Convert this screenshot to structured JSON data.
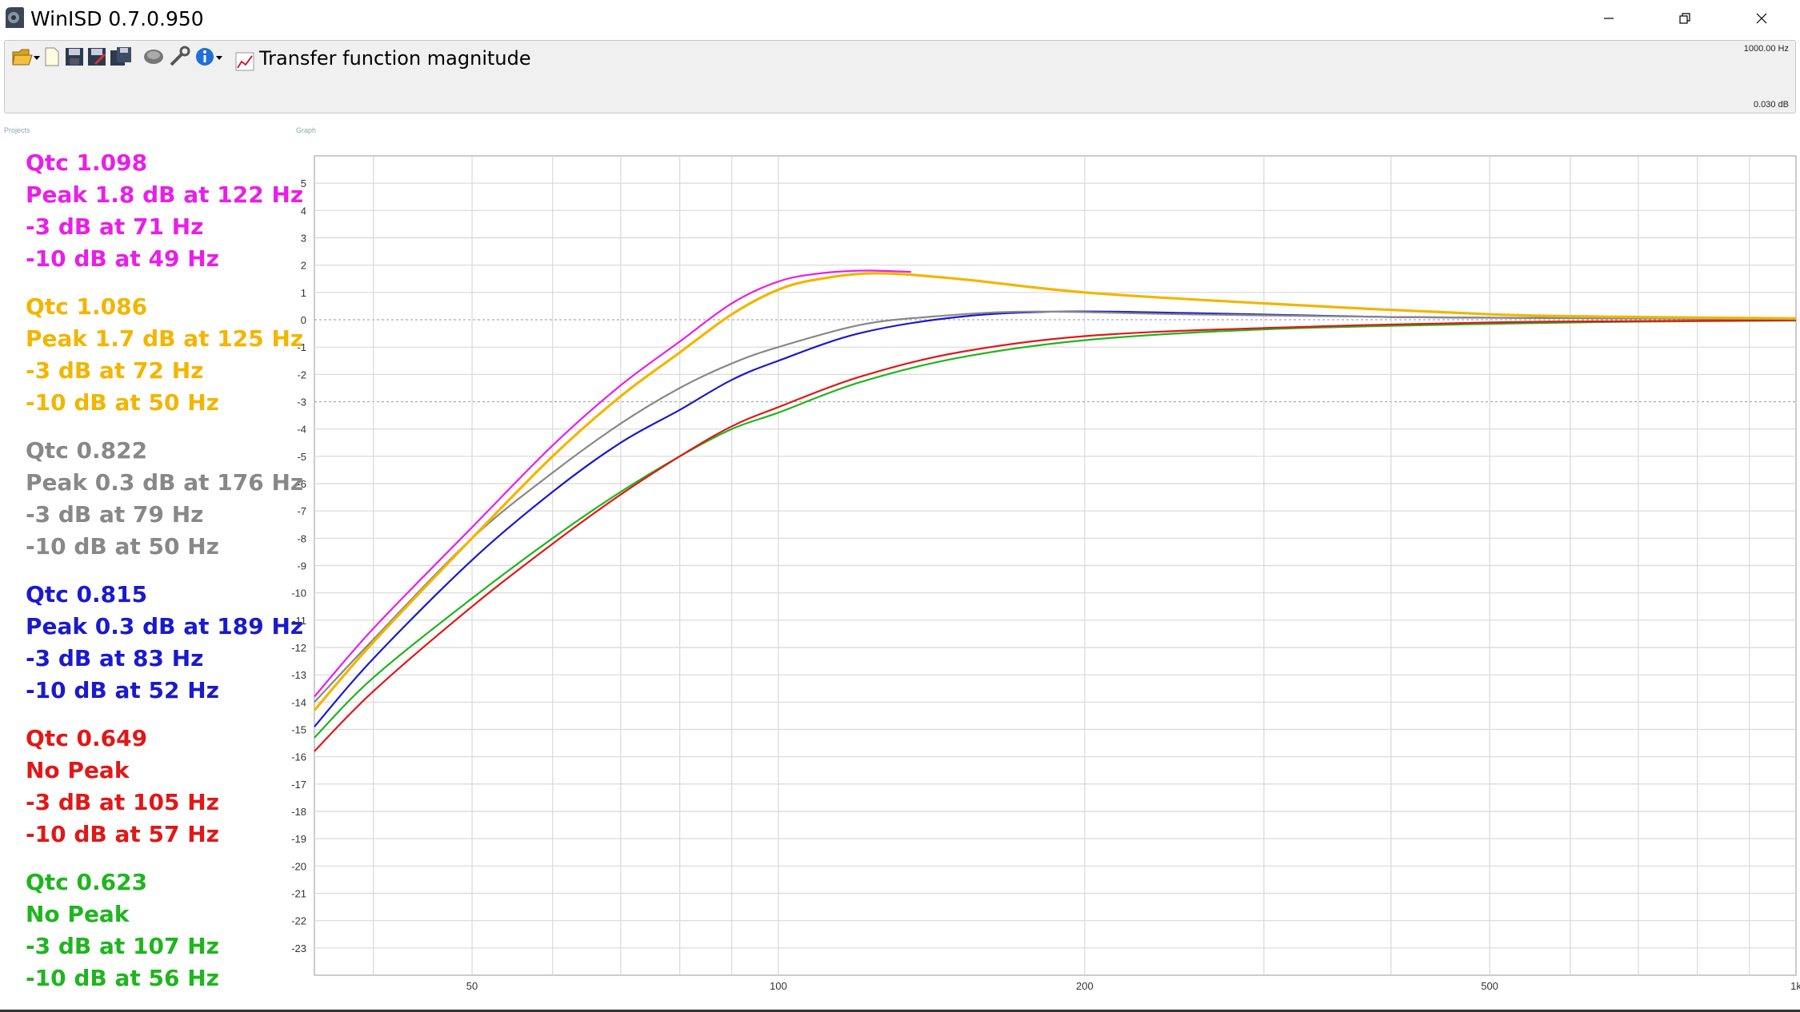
{
  "window": {
    "title": "WinISD 0.7.0.950",
    "controls": [
      "minimize",
      "maximize",
      "close"
    ]
  },
  "toolbar": {
    "icons": [
      "folder-open-icon",
      "new-file-icon",
      "save-icon",
      "save-as-icon",
      "save-all-icon",
      "driver-icon",
      "tools-icon",
      "info-icon"
    ],
    "graph_label": "Transfer function magnitude",
    "freq_readout": "1000.00 Hz",
    "db_readout": "0.030 dB"
  },
  "panels": {
    "projects_caption": "Projects",
    "graph_caption": "Graph"
  },
  "annotations": [
    {
      "color": "#e81fe8",
      "lines": [
        "Qtc 1.098",
        "Peak 1.8 dB at 122 Hz",
        "-3 dB at 71 Hz",
        "-10 dB at 49 Hz"
      ]
    },
    {
      "color": "#f2b500",
      "lines": [
        "Qtc 1.086",
        "Peak 1.7 dB at 125 Hz",
        "-3 dB at 72 Hz",
        "-10 dB at 50 Hz"
      ]
    },
    {
      "color": "#888888",
      "lines": [
        "Qtc 0.822",
        "Peak 0.3 dB at 176 Hz",
        "-3 dB at 79 Hz",
        "-10 dB at 50 Hz"
      ]
    },
    {
      "color": "#1a1acc",
      "lines": [
        "Qtc 0.815",
        "Peak 0.3 dB at 189 Hz",
        "-3 dB at 83 Hz",
        "-10 dB at 52 Hz"
      ]
    },
    {
      "color": "#e01818",
      "lines": [
        "Qtc 0.649",
        "No Peak",
        "-3 dB at 105 Hz",
        "-10 dB at 57 Hz"
      ]
    },
    {
      "color": "#1fb51f",
      "lines": [
        "Qtc 0.623",
        "No Peak",
        "-3 dB at 107 Hz",
        "-10 dB at 56 Hz"
      ]
    }
  ],
  "chart_data": {
    "type": "line",
    "x_scale": "log",
    "xlim": [
      35,
      1000
    ],
    "ylim": [
      -24,
      6
    ],
    "x_ticks": [
      50,
      100,
      200,
      500,
      1000
    ],
    "x_tick_labels": [
      "50",
      "100",
      "200",
      "500",
      "1k"
    ],
    "y_ticks": [
      5,
      4,
      3,
      2,
      1,
      0,
      -1,
      -2,
      -3,
      -4,
      -5,
      -6,
      -7,
      -8,
      -9,
      -10,
      -11,
      -12,
      -13,
      -14,
      -15,
      -16,
      -17,
      -18,
      -19,
      -20,
      -21,
      -22,
      -23
    ],
    "x_grid": [
      40,
      50,
      60,
      70,
      80,
      90,
      100,
      200,
      300,
      400,
      500,
      600,
      700,
      800,
      900
    ],
    "dotted_y": [
      0,
      -3
    ],
    "series": [
      {
        "color": "#e81fe8",
        "qtc": 1.098,
        "x": [
          35,
          40,
          50,
          60,
          70,
          80,
          90,
          100,
          110,
          122,
          135
        ],
        "y": [
          -13.8,
          -11.3,
          -7.6,
          -4.6,
          -2.4,
          -0.8,
          0.6,
          1.4,
          1.7,
          1.8,
          1.75
        ]
      },
      {
        "color": "#f2b500",
        "qtc": 1.086,
        "x": [
          35,
          40,
          50,
          60,
          70,
          80,
          90,
          100,
          110,
          125,
          150,
          200,
          300,
          500,
          700,
          1000
        ],
        "y": [
          -14.3,
          -11.8,
          -8.0,
          -5.0,
          -2.8,
          -1.2,
          0.2,
          1.1,
          1.5,
          1.7,
          1.5,
          1.0,
          0.6,
          0.2,
          0.1,
          0.05
        ]
      },
      {
        "color": "#888888",
        "qtc": 0.822,
        "x": [
          35,
          40,
          50,
          60,
          70,
          80,
          90,
          100,
          120,
          140,
          176,
          250,
          400,
          700,
          1000
        ],
        "y": [
          -14.0,
          -11.7,
          -8.0,
          -5.6,
          -3.8,
          -2.5,
          -1.6,
          -1.0,
          -0.2,
          0.1,
          0.3,
          0.2,
          0.1,
          0.05,
          0.02
        ]
      },
      {
        "color": "#1a1acc",
        "qtc": 0.815,
        "x": [
          35,
          40,
          50,
          60,
          70,
          80,
          90,
          100,
          120,
          150,
          189,
          250,
          400,
          700,
          1000
        ],
        "y": [
          -14.9,
          -12.4,
          -8.8,
          -6.3,
          -4.5,
          -3.3,
          -2.2,
          -1.5,
          -0.5,
          0.1,
          0.3,
          0.25,
          0.1,
          0.05,
          0.02
        ]
      },
      {
        "color": "#e01818",
        "qtc": 0.649,
        "x": [
          35,
          40,
          50,
          60,
          70,
          80,
          90,
          100,
          120,
          150,
          200,
          300,
          500,
          700,
          1000
        ],
        "y": [
          -15.8,
          -13.6,
          -10.5,
          -8.2,
          -6.4,
          -5.0,
          -3.9,
          -3.2,
          -2.1,
          -1.2,
          -0.6,
          -0.3,
          -0.1,
          -0.05,
          -0.02
        ]
      },
      {
        "color": "#1fb51f",
        "qtc": 0.623,
        "x": [
          35,
          40,
          50,
          60,
          70,
          80,
          90,
          100,
          120,
          150,
          200,
          300,
          500,
          700,
          1000
        ],
        "y": [
          -15.3,
          -13.1,
          -10.2,
          -8.0,
          -6.3,
          -5.0,
          -4.0,
          -3.4,
          -2.3,
          -1.4,
          -0.75,
          -0.35,
          -0.15,
          -0.07,
          -0.03
        ]
      }
    ]
  }
}
